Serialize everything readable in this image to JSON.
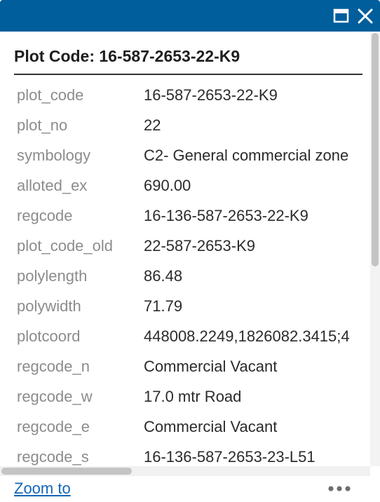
{
  "popup": {
    "title": "Plot Code: 16-587-2653-22-K9",
    "header_icons": {
      "maximize": "maximize-icon",
      "close": "close-icon"
    },
    "colors": {
      "header": "#005e9c",
      "link": "#1266b8"
    }
  },
  "attributes": [
    {
      "key": "plot_code",
      "value": "16-587-2653-22-K9"
    },
    {
      "key": "plot_no",
      "value": "22"
    },
    {
      "key": "symbology",
      "value": "C2- General commercial zone"
    },
    {
      "key": "alloted_ex",
      "value": "690.00"
    },
    {
      "key": "regcode",
      "value": "16-136-587-2653-22-K9"
    },
    {
      "key": "plot_code_old",
      "value": "22-587-2653-K9"
    },
    {
      "key": "polylength",
      "value": "86.48"
    },
    {
      "key": "polywidth",
      "value": "71.79"
    },
    {
      "key": "plotcoord",
      "value": "448008.2249,1826082.3415;4"
    },
    {
      "key": "regcode_n",
      "value": "Commercial Vacant"
    },
    {
      "key": "regcode_w",
      "value": "17.0 mtr Road"
    },
    {
      "key": "regcode_e",
      "value": "Commercial Vacant"
    },
    {
      "key": "regcode_s",
      "value": "16-136-587-2653-23-L51"
    }
  ],
  "footer": {
    "zoom_label": "Zoom to",
    "more_icon": "more-options-icon"
  }
}
